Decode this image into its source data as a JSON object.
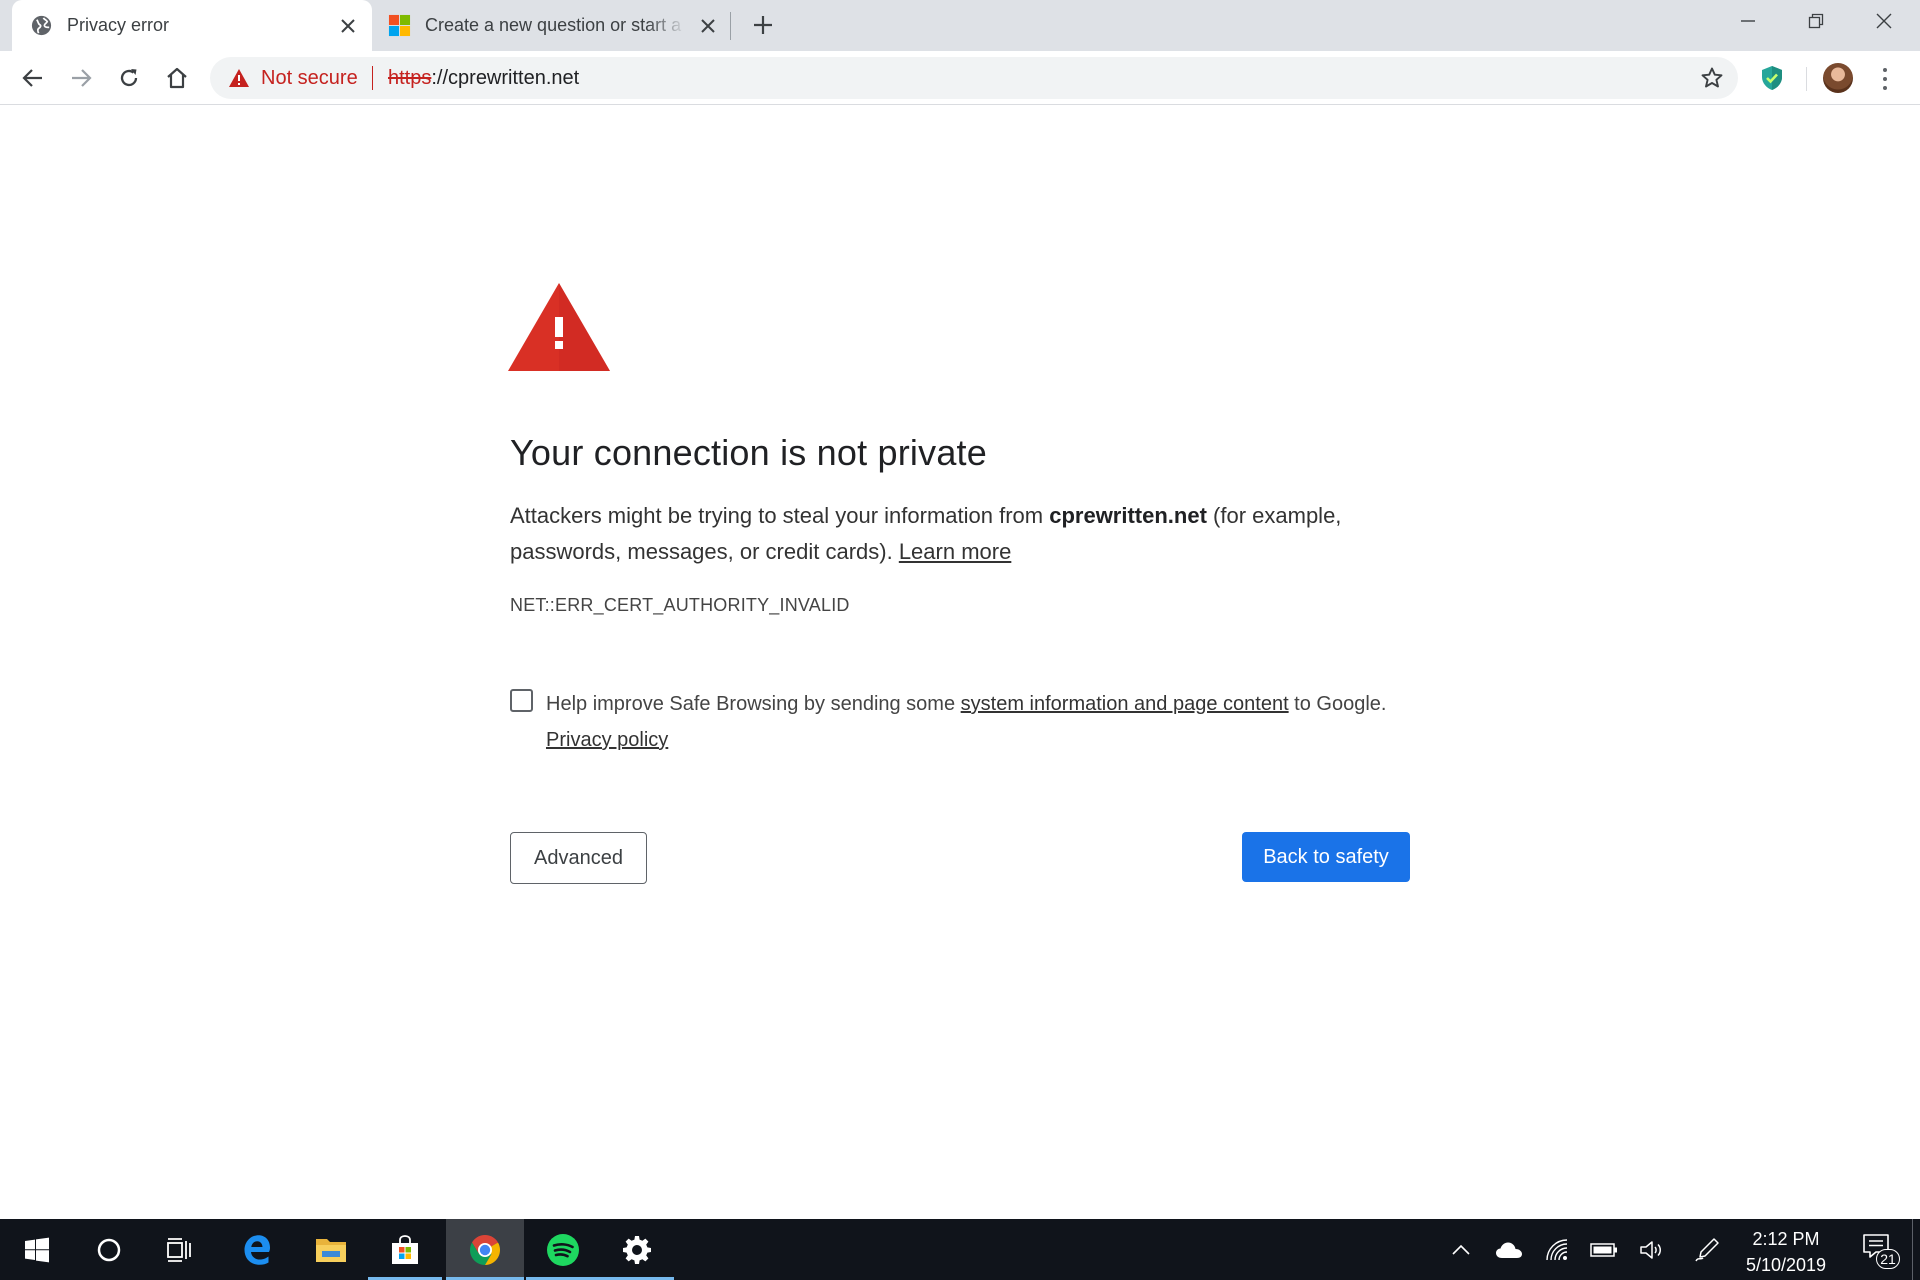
{
  "browser": {
    "tabs": [
      {
        "title": "Privacy error",
        "active": true,
        "icon": "globe-icon"
      },
      {
        "title": "Create a new question or start a discussion",
        "active": false,
        "icon": "microsoft-logo-icon"
      }
    ],
    "omnibox": {
      "security_label": "Not secure",
      "url_scheme": "https",
      "url_rest": "://cprewritten.net"
    }
  },
  "page": {
    "heading": "Your connection is not private",
    "description": {
      "before": "Attackers might be trying to steal your information from ",
      "domain": "cprewritten.net",
      "after": " (for example, passwords, messages, or credit cards). ",
      "learn_more": "Learn more"
    },
    "error_code": "NET::ERR_CERT_AUTHORITY_INVALID",
    "optin": {
      "before": "Help improve Safe Browsing by sending some ",
      "link": "system information and page content",
      "after": " to Google. ",
      "privacy_link": "Privacy policy",
      "checked": false
    },
    "buttons": {
      "advanced": "Advanced",
      "back_to_safety": "Back to safety"
    }
  },
  "taskbar": {
    "apps": [
      "windows-start-icon",
      "cortana-icon",
      "task-view-icon",
      "edge-icon",
      "file-explorer-icon",
      "store-icon",
      "chrome-icon",
      "spotify-icon",
      "settings-icon"
    ],
    "clock": {
      "time": "2:12 PM",
      "date": "5/10/2019"
    },
    "notification_count": "21"
  },
  "colors": {
    "warning_red": "#d93025",
    "primary_blue": "#1a73e8",
    "tabstrip": "#dee1e6",
    "taskbar": "#10141b"
  }
}
